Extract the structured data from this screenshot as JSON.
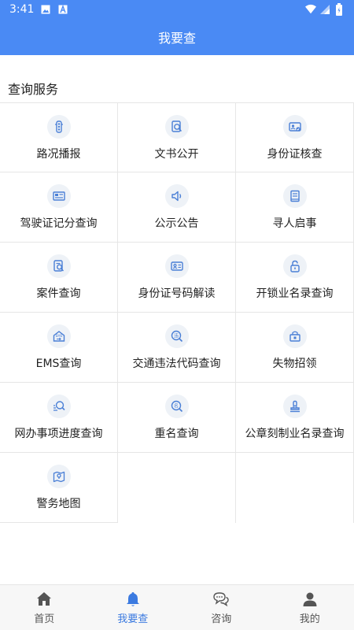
{
  "status_bar": {
    "time": "3:41"
  },
  "header": {
    "title": "我要查"
  },
  "section": {
    "title": "查询服务"
  },
  "services": [
    {
      "label": "路况播报",
      "icon": "traffic-light-icon"
    },
    {
      "label": "文书公开",
      "icon": "document-search-icon"
    },
    {
      "label": "身份证核查",
      "icon": "id-card-check-icon"
    },
    {
      "label": "驾驶证记分查询",
      "icon": "license-icon"
    },
    {
      "label": "公示公告",
      "icon": "speaker-icon"
    },
    {
      "label": "寻人启事",
      "icon": "notice-icon"
    },
    {
      "label": "案件查询",
      "icon": "case-search-icon"
    },
    {
      "label": "身份证号码解读",
      "icon": "id-number-icon"
    },
    {
      "label": "开锁业名录查询",
      "icon": "lock-icon"
    },
    {
      "label": "EMS查询",
      "icon": "ems-icon"
    },
    {
      "label": "交通违法代码查询",
      "icon": "violation-search-icon"
    },
    {
      "label": "失物招领",
      "icon": "lost-found-icon"
    },
    {
      "label": "网办事项进度查询",
      "icon": "progress-search-icon"
    },
    {
      "label": "重名查询",
      "icon": "name-search-icon"
    },
    {
      "label": "公章刻制业名录查询",
      "icon": "stamp-icon"
    },
    {
      "label": "警务地图",
      "icon": "map-icon"
    }
  ],
  "nav": [
    {
      "label": "首页",
      "icon": "home-icon",
      "active": false
    },
    {
      "label": "我要查",
      "icon": "bell-icon",
      "active": true
    },
    {
      "label": "咨询",
      "icon": "chat-icon",
      "active": false
    },
    {
      "label": "我的",
      "icon": "person-icon",
      "active": false
    }
  ],
  "colors": {
    "primary": "#4a8af4",
    "active_nav": "#3b7ae0",
    "icon": "#4a7fd6"
  }
}
